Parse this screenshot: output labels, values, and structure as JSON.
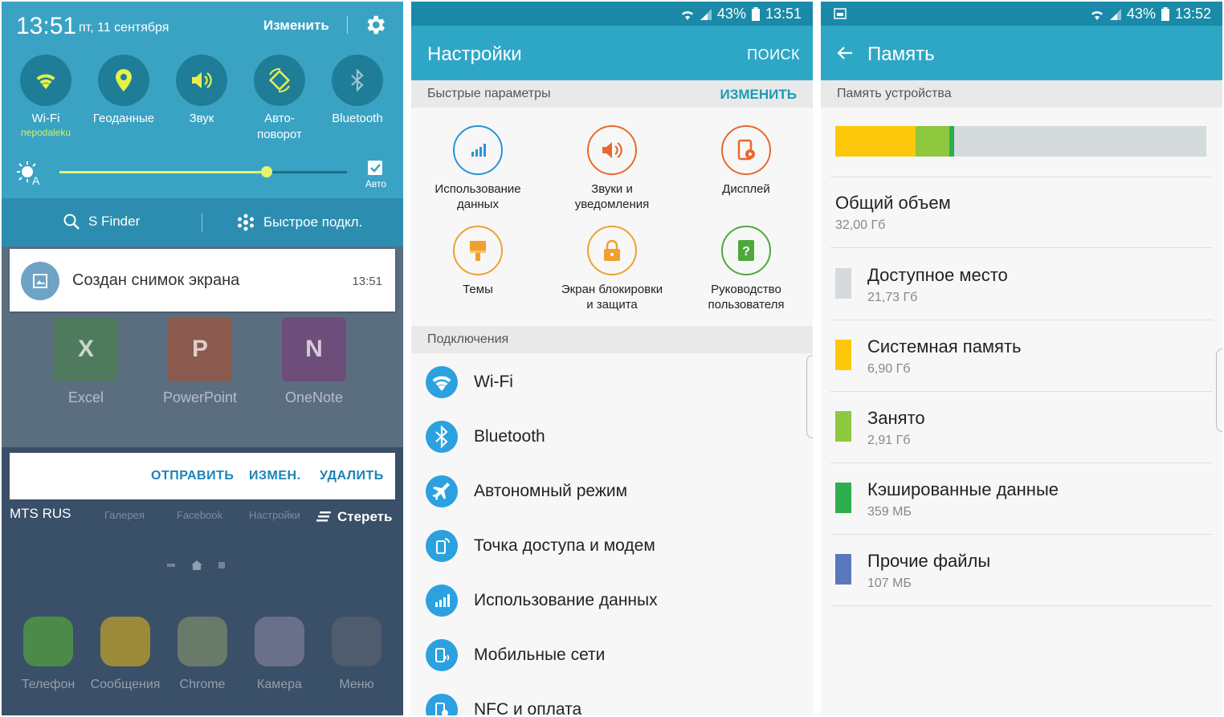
{
  "s1": {
    "time": "13:51",
    "date": "пт, 11 сентября",
    "edit": "Изменить",
    "tiles": [
      {
        "label": "Wi-Fi",
        "sub": "nepodaleku",
        "icon": "wifi-icon",
        "color": "#e8f04a"
      },
      {
        "label": "Геоданные",
        "sub": "",
        "icon": "location-icon",
        "color": "#e8f04a"
      },
      {
        "label": "Звук",
        "sub": "",
        "icon": "sound-icon",
        "color": "#e8f04a"
      },
      {
        "label": "Авто-\nповорот",
        "sub": "",
        "icon": "rotate-icon",
        "color": "#e8f04a"
      },
      {
        "label": "Bluetooth",
        "sub": "",
        "icon": "bluetooth-icon",
        "color": "#9cc6d6"
      }
    ],
    "brightness": 0.72,
    "auto_label": "Авто",
    "finder": "S Finder",
    "quick_connect": "Быстрое подкл.",
    "notification": {
      "title": "Создан снимок экрана",
      "time": "13:51",
      "actions": [
        "ОТПРАВИТЬ",
        "ИЗМЕН.",
        "УДАЛИТЬ"
      ]
    },
    "ghost_apps": [
      {
        "label": "Excel",
        "letter": "X",
        "color": "#4f7a5e"
      },
      {
        "label": "PowerPoint",
        "letter": "P",
        "color": "#8a5a4e"
      },
      {
        "label": "OneNote",
        "letter": "N",
        "color": "#6d4d7a"
      }
    ],
    "carrier": "MTS RUS",
    "ghost_tabs": [
      "Галерея",
      "Facebook",
      "Настройки"
    ],
    "clear": "Стереть",
    "dock": [
      {
        "label": "Телефон",
        "color": "#4c8a4a"
      },
      {
        "label": "Сообщения",
        "color": "#9a8a3a"
      },
      {
        "label": "Chrome",
        "color": "#6a7a6a"
      },
      {
        "label": "Камера",
        "color": "#6a6f8a"
      },
      {
        "label": "Меню",
        "color": "#4f5c6e"
      }
    ]
  },
  "s2": {
    "battery": "43%",
    "time": "13:51",
    "title": "Настройки",
    "search": "ПОИСК",
    "quick_section": "Быстрые параметры",
    "quick_edit": "ИЗМЕНИТЬ",
    "quick": [
      {
        "label": "Использование\nданных",
        "icon": "data-usage-icon",
        "color": "#2a93d6"
      },
      {
        "label": "Звуки и\nуведомления",
        "icon": "sound-icon",
        "color": "#e8692c"
      },
      {
        "label": "Дисплей",
        "icon": "display-icon",
        "color": "#e8692c"
      },
      {
        "label": "Темы",
        "icon": "theme-brush-icon",
        "color": "#f0a030"
      },
      {
        "label": "Экран блокировки\nи защита",
        "icon": "lock-icon",
        "color": "#f0a030"
      },
      {
        "label": "Руководство\nпользователя",
        "icon": "help-book-icon",
        "color": "#4caa3c"
      }
    ],
    "conn_section": "Подключения",
    "rows": [
      {
        "label": "Wi-Fi",
        "icon": "wifi-icon"
      },
      {
        "label": "Bluetooth",
        "icon": "bluetooth-icon"
      },
      {
        "label": "Автономный режим",
        "icon": "airplane-icon"
      },
      {
        "label": "Точка доступа и модем",
        "icon": "hotspot-icon"
      },
      {
        "label": "Использование данных",
        "icon": "data-usage-icon"
      },
      {
        "label": "Мобильные сети",
        "icon": "mobile-network-icon"
      },
      {
        "label": "NFC и оплата",
        "icon": "nfc-icon"
      }
    ]
  },
  "s3": {
    "battery": "43%",
    "time": "13:52",
    "title": "Память",
    "section": "Память устройства",
    "total_label": "Общий объем",
    "total_value": "32,00 Гб",
    "bar": [
      {
        "value": 6.9,
        "color": "#fdc70c"
      },
      {
        "value": 2.91,
        "color": "#8dc83f"
      },
      {
        "value": 0.359,
        "color": "#2db04b"
      },
      {
        "value": 0.107,
        "color": "#5b78bf"
      },
      {
        "value": 21.73,
        "color": "#d5dadd"
      }
    ],
    "items": [
      {
        "label": "Доступное место",
        "value": "21,73 Гб",
        "color": "#d5dadd"
      },
      {
        "label": "Системная память",
        "value": "6,90 Гб",
        "color": "#fdc70c"
      },
      {
        "label": "Занято",
        "value": "2,91 Гб",
        "color": "#8dc83f"
      },
      {
        "label": "Кэшированные данные",
        "value": "359 МБ",
        "color": "#2db04b"
      },
      {
        "label": "Прочие файлы",
        "value": "107 МБ",
        "color": "#5b78bf"
      }
    ]
  }
}
